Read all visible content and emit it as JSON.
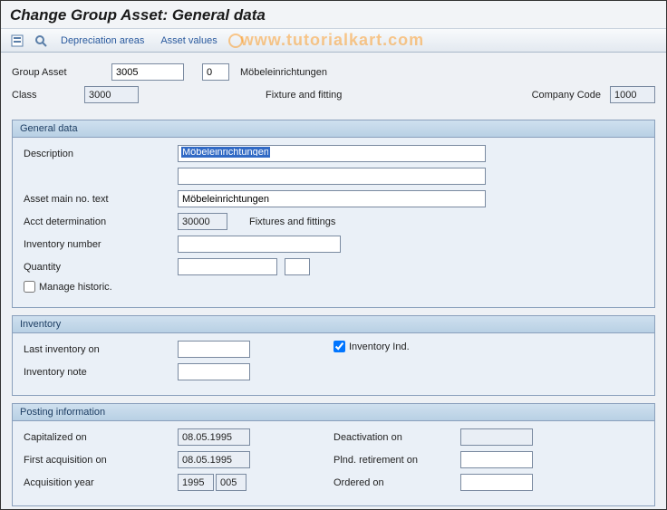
{
  "title": "Change Group Asset: General data",
  "watermark": "www.tutorialkart.com",
  "toolbar": {
    "dep_areas": "Depreciation areas",
    "asset_values": "Asset values"
  },
  "header": {
    "group_asset_label": "Group Asset",
    "group_asset": "3005",
    "group_asset_sub": "0",
    "group_asset_text": "Möbeleinrichtungen",
    "class_label": "Class",
    "class": "3000",
    "class_text": "Fixture and fitting",
    "company_code_label": "Company Code",
    "company_code": "1000"
  },
  "general": {
    "legend": "General data",
    "description_label": "Description",
    "description": "Möbeleinrichtungen",
    "description2": "",
    "asset_main_label": "Asset main no. text",
    "asset_main": "Möbeleinrichtungen",
    "acct_det_label": "Acct determination",
    "acct_det": "30000",
    "acct_det_text": "Fixtures and fittings",
    "inv_no_label": "Inventory number",
    "inv_no": "",
    "qty_label": "Quantity",
    "qty": "",
    "uom": "",
    "manage_hist_label": "Manage historic.",
    "manage_hist": false
  },
  "inventory": {
    "legend": "Inventory",
    "last_inv_label": "Last inventory on",
    "last_inv": "",
    "inv_ind_label": "Inventory Ind.",
    "inv_ind": true,
    "inv_note_label": "Inventory note",
    "inv_note": ""
  },
  "posting": {
    "legend": "Posting information",
    "cap_on_label": "Capitalized on",
    "cap_on": "08.05.1995",
    "first_acq_label": "First acquisition on",
    "first_acq": "08.05.1995",
    "acq_year_label": "Acquisition year",
    "acq_year": "1995",
    "acq_period": "005",
    "deact_label": "Deactivation on",
    "deact": "",
    "plnd_label": "Plnd. retirement on",
    "plnd": "",
    "ordered_label": "Ordered on",
    "ordered": ""
  }
}
